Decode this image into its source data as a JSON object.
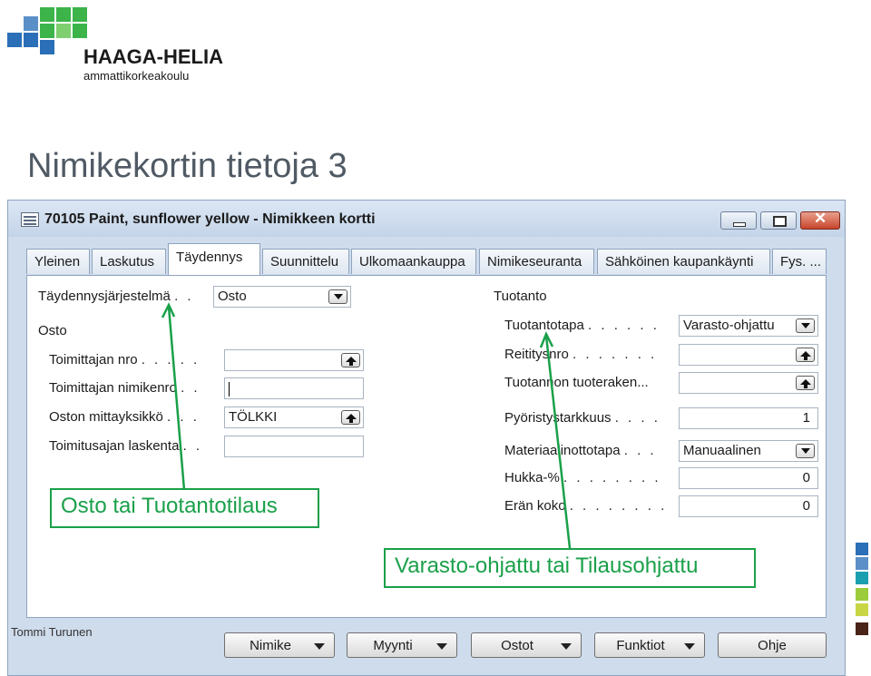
{
  "logo": {
    "name": "HAAGA-HELIA",
    "subtitle": "ammattikorkeakoulu",
    "colors": {
      "blue": "#2a6fb7",
      "green": "#3cb44a"
    }
  },
  "slide": {
    "title": "Nimikekortin tietoja 3",
    "author": "Tommi Turunen"
  },
  "window": {
    "title": "70105 Paint, sunflower yellow - Nimikkeen kortti",
    "icon": "grid-card-icon",
    "controls": [
      "minimize-icon",
      "maximize-icon",
      "close-icon"
    ]
  },
  "tabs": [
    {
      "label": "Yleinen"
    },
    {
      "label": "Laskutus"
    },
    {
      "label": "Täydennys",
      "active": true
    },
    {
      "label": "Suunnittelu"
    },
    {
      "label": "Ulkomaankauppa"
    },
    {
      "label": "Nimikeseuranta"
    },
    {
      "label": "Sähköinen kaupankäynti"
    },
    {
      "label": "Fys. ..."
    }
  ],
  "left": {
    "replenishment_label": "Täydennysjärjestelmä",
    "replenishment_dots": ". .",
    "replenishment_value": "Osto",
    "purchase_heading": "Osto",
    "vendor_no_label": "Toimittajan nro",
    "vendor_no_dots": ". . . . .",
    "vendor_no_value": "",
    "vendor_item_label": "Toimittajan nimikenro",
    "vendor_item_dots": ". .",
    "vendor_item_value": "",
    "purch_uom_label": "Oston mittayksikkö",
    "purch_uom_dots": ". . .",
    "purch_uom_value": "TÖLKKI",
    "lead_time_label": "Toimitusajan laskenta",
    "lead_time_dots": ". .",
    "lead_time_value": ""
  },
  "right": {
    "production_heading": "Tuotanto",
    "policy_label": "Tuotantotapa",
    "policy_dots": ". . . . . .",
    "policy_value": "Varasto-ohjattu",
    "routing_label": "Reititysnro",
    "routing_dots": ". . . . . . .",
    "routing_value": "",
    "bom_label": "Tuotannon tuoteraken...",
    "bom_value": "",
    "rounding_label": "Pyöristystarkkuus",
    "rounding_dots": ". . . .",
    "rounding_value": "1",
    "flushing_label": "Materiaalinottotapa",
    "flushing_dots": ". . .",
    "flushing_value": "Manuaalinen",
    "scrap_label": "Hukka-%",
    "scrap_dots": ". . . . . . . .",
    "scrap_value": "0",
    "lot_label": "Erän koko",
    "lot_dots": ". . . . . . . .",
    "lot_value": "0"
  },
  "bottom_buttons": {
    "item": "Nimike",
    "sales": "Myynti",
    "purchases": "Ostot",
    "functions": "Funktiot",
    "help": "Ohje"
  },
  "callouts": {
    "left": "Osto tai Tuotantotilaus",
    "right": "Varasto-ohjattu tai Tilausohjattu",
    "color": "#1aa04a"
  },
  "side_palette": [
    "#2a6fb7",
    "#5b8fc8",
    "#1a9fb0",
    "#9ccc3c",
    "#c8d646",
    "#4a2418"
  ]
}
